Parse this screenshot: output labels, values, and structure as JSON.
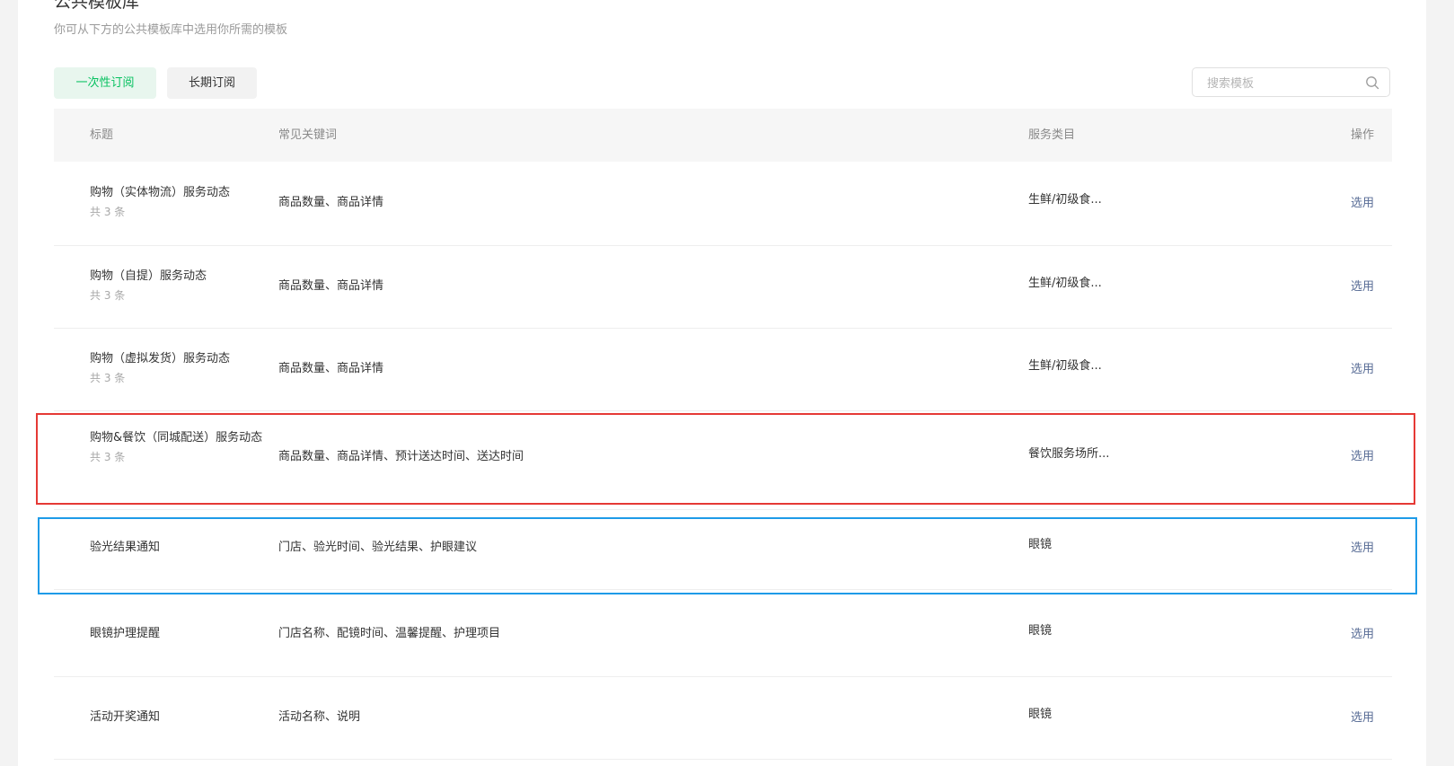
{
  "header": {
    "title": "公共模板库",
    "subtitle": "你可从下方的公共模板库中选用你所需的模板"
  },
  "tabs": [
    {
      "label": "一次性订阅",
      "active": true
    },
    {
      "label": "长期订阅",
      "active": false
    }
  ],
  "search": {
    "placeholder": "搜索模板",
    "value": ""
  },
  "table": {
    "columns": {
      "title": "标题",
      "keywords": "常见关键词",
      "category": "服务类目",
      "action": "操作"
    },
    "rows": [
      {
        "title": "购物（实体物流）服务动态",
        "count": "共 3 条",
        "keywords": "商品数量、商品详情",
        "category": "生鲜/初级食...",
        "action": "选用"
      },
      {
        "title": "购物（自提）服务动态",
        "count": "共 3 条",
        "keywords": "商品数量、商品详情",
        "category": "生鲜/初级食...",
        "action": "选用"
      },
      {
        "title": "购物（虚拟发货）服务动态",
        "count": "共 3 条",
        "keywords": "商品数量、商品详情",
        "category": "生鲜/初级食...",
        "action": "选用"
      },
      {
        "title": "购物&餐饮（同城配送）服务动态",
        "count": "共 3 条",
        "keywords": "商品数量、商品详情、预计送达时间、送达时间",
        "category": "餐饮服务场所...",
        "action": "选用"
      },
      {
        "title": "验光结果通知",
        "count": "",
        "keywords": "门店、验光时间、验光结果、护眼建议",
        "category": "眼镜",
        "action": "选用"
      },
      {
        "title": "眼镜护理提醒",
        "count": "",
        "keywords": "门店名称、配镜时间、温馨提醒、护理项目",
        "category": "眼镜",
        "action": "选用"
      },
      {
        "title": "活动开奖通知",
        "count": "",
        "keywords": "活动名称、说明",
        "category": "眼镜",
        "action": "选用"
      }
    ]
  },
  "colors": {
    "accent_green": "#07c160",
    "link_blue": "#576b95",
    "highlight_red": "#e53935",
    "highlight_blue": "#1e9be8"
  }
}
